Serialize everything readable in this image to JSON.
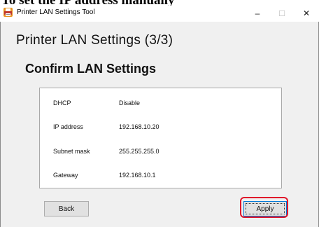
{
  "document": {
    "heading": "To set the IP address manually"
  },
  "window": {
    "title": "Printer LAN Settings Tool",
    "controls": {
      "minimize": "–",
      "maximize": "☐",
      "close": "✕"
    },
    "app_icon": "printer-app-icon"
  },
  "main": {
    "title": "Printer LAN Settings (3/3)",
    "subtitle": "Confirm LAN Settings"
  },
  "settings": [
    {
      "label": "DHCP",
      "value": "Disable"
    },
    {
      "label": "IP address",
      "value": "192.168.10.20"
    },
    {
      "label": "Subnet mask",
      "value": "255.255.255.0"
    },
    {
      "label": "Gateway",
      "value": "192.168.10.1"
    }
  ],
  "buttons": {
    "back": "Back",
    "apply": "Apply"
  },
  "colors": {
    "highlight": "#e0162b",
    "app_icon": "#e8921e",
    "focus_border": "#0078d7"
  }
}
